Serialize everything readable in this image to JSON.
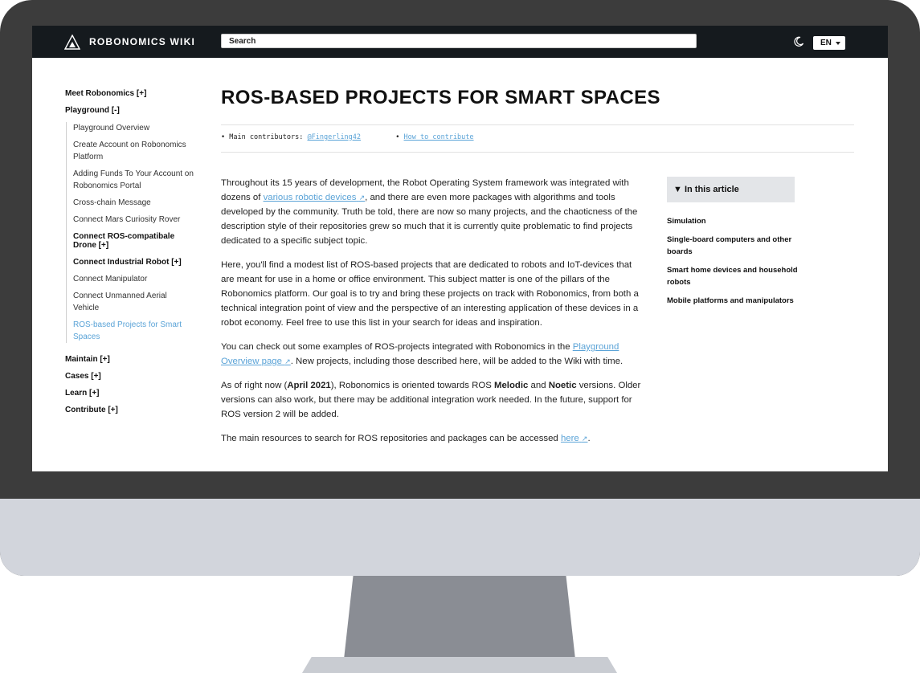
{
  "header": {
    "brand": "ROBONOMICS WIKI",
    "search_placeholder": "Search",
    "language": "EN"
  },
  "sidebar": {
    "meet": "Meet Robonomics [+]",
    "playground": "Playground [-]",
    "items": [
      {
        "label": "Playground Overview"
      },
      {
        "label": "Create Account on Robonomics Platform"
      },
      {
        "label": "Adding Funds To Your Account on Robonomics Portal"
      },
      {
        "label": "Cross-chain Message"
      },
      {
        "label": "Connect Mars Curiosity Rover"
      },
      {
        "label": "Connect ROS-compatibale Drone [+]"
      },
      {
        "label": "Connect Industrial Robot [+]"
      },
      {
        "label": "Connect Manipulator"
      },
      {
        "label": "Connect Unmanned Aerial Vehicle"
      },
      {
        "label": "ROS-based Projects for Smart Spaces"
      }
    ],
    "maintain": "Maintain [+]",
    "cases": "Cases [+]",
    "learn": "Learn [+]",
    "contribute": "Contribute [+]"
  },
  "page": {
    "title": "ROS-BASED PROJECTS FOR SMART SPACES",
    "contributors_label": "Main contributors:",
    "contributor": "@Fingerling42",
    "how_to": "How to contribute"
  },
  "article": {
    "p1_a": "Throughout its 15 years of development, the Robot Operating System framework was integrated with dozens of ",
    "p1_link": "various robotic devices",
    "p1_b": ", and there are even more packages with algorithms and tools developed by the community. Truth be told, there are now so many projects, and the chaoticness of the description style of their repositories grew so much that it is currently quite problematic to find projects dedicated to a specific subject topic.",
    "p2": "Here, you'll find a modest list of ROS-based projects that are dedicated to robots and IoT-devices that are meant for use in a home or office environment. This subject matter is one of the pillars of the Robonomics platform. Our goal is to try and bring these projects on track with Robonomics, from both a technical integration point of view and the perspective of an interesting application of these devices in a robot economy. Feel free to use this list in your search for ideas and inspiration.",
    "p3_a": "You can check out some examples of ROS-projects integrated with Robonomics in the ",
    "p3_link": "Playground Overview page",
    "p3_b": ". New projects, including those described here, will be added to the Wiki with time.",
    "p4_a": "As of right now (",
    "p4_date": "April 2021",
    "p4_b": "), Robonomics is oriented towards ROS ",
    "p4_melodic": "Melodic",
    "p4_c": " and ",
    "p4_noetic": "Noetic",
    "p4_d": " versions. Older versions can also work, but there may be additional integration work needed. In the future, support for ROS version 2 will be added.",
    "p5_a": "The main resources to search for ROS repositories and packages can be accessed ",
    "p5_link": "here",
    "p5_b": "."
  },
  "toc": {
    "header": "▼ In this article",
    "items": [
      {
        "label": "Simulation"
      },
      {
        "label": "Single-board computers and other boards"
      },
      {
        "label": "Smart home devices and household robots"
      },
      {
        "label": "Mobile platforms and manipulators"
      }
    ]
  }
}
